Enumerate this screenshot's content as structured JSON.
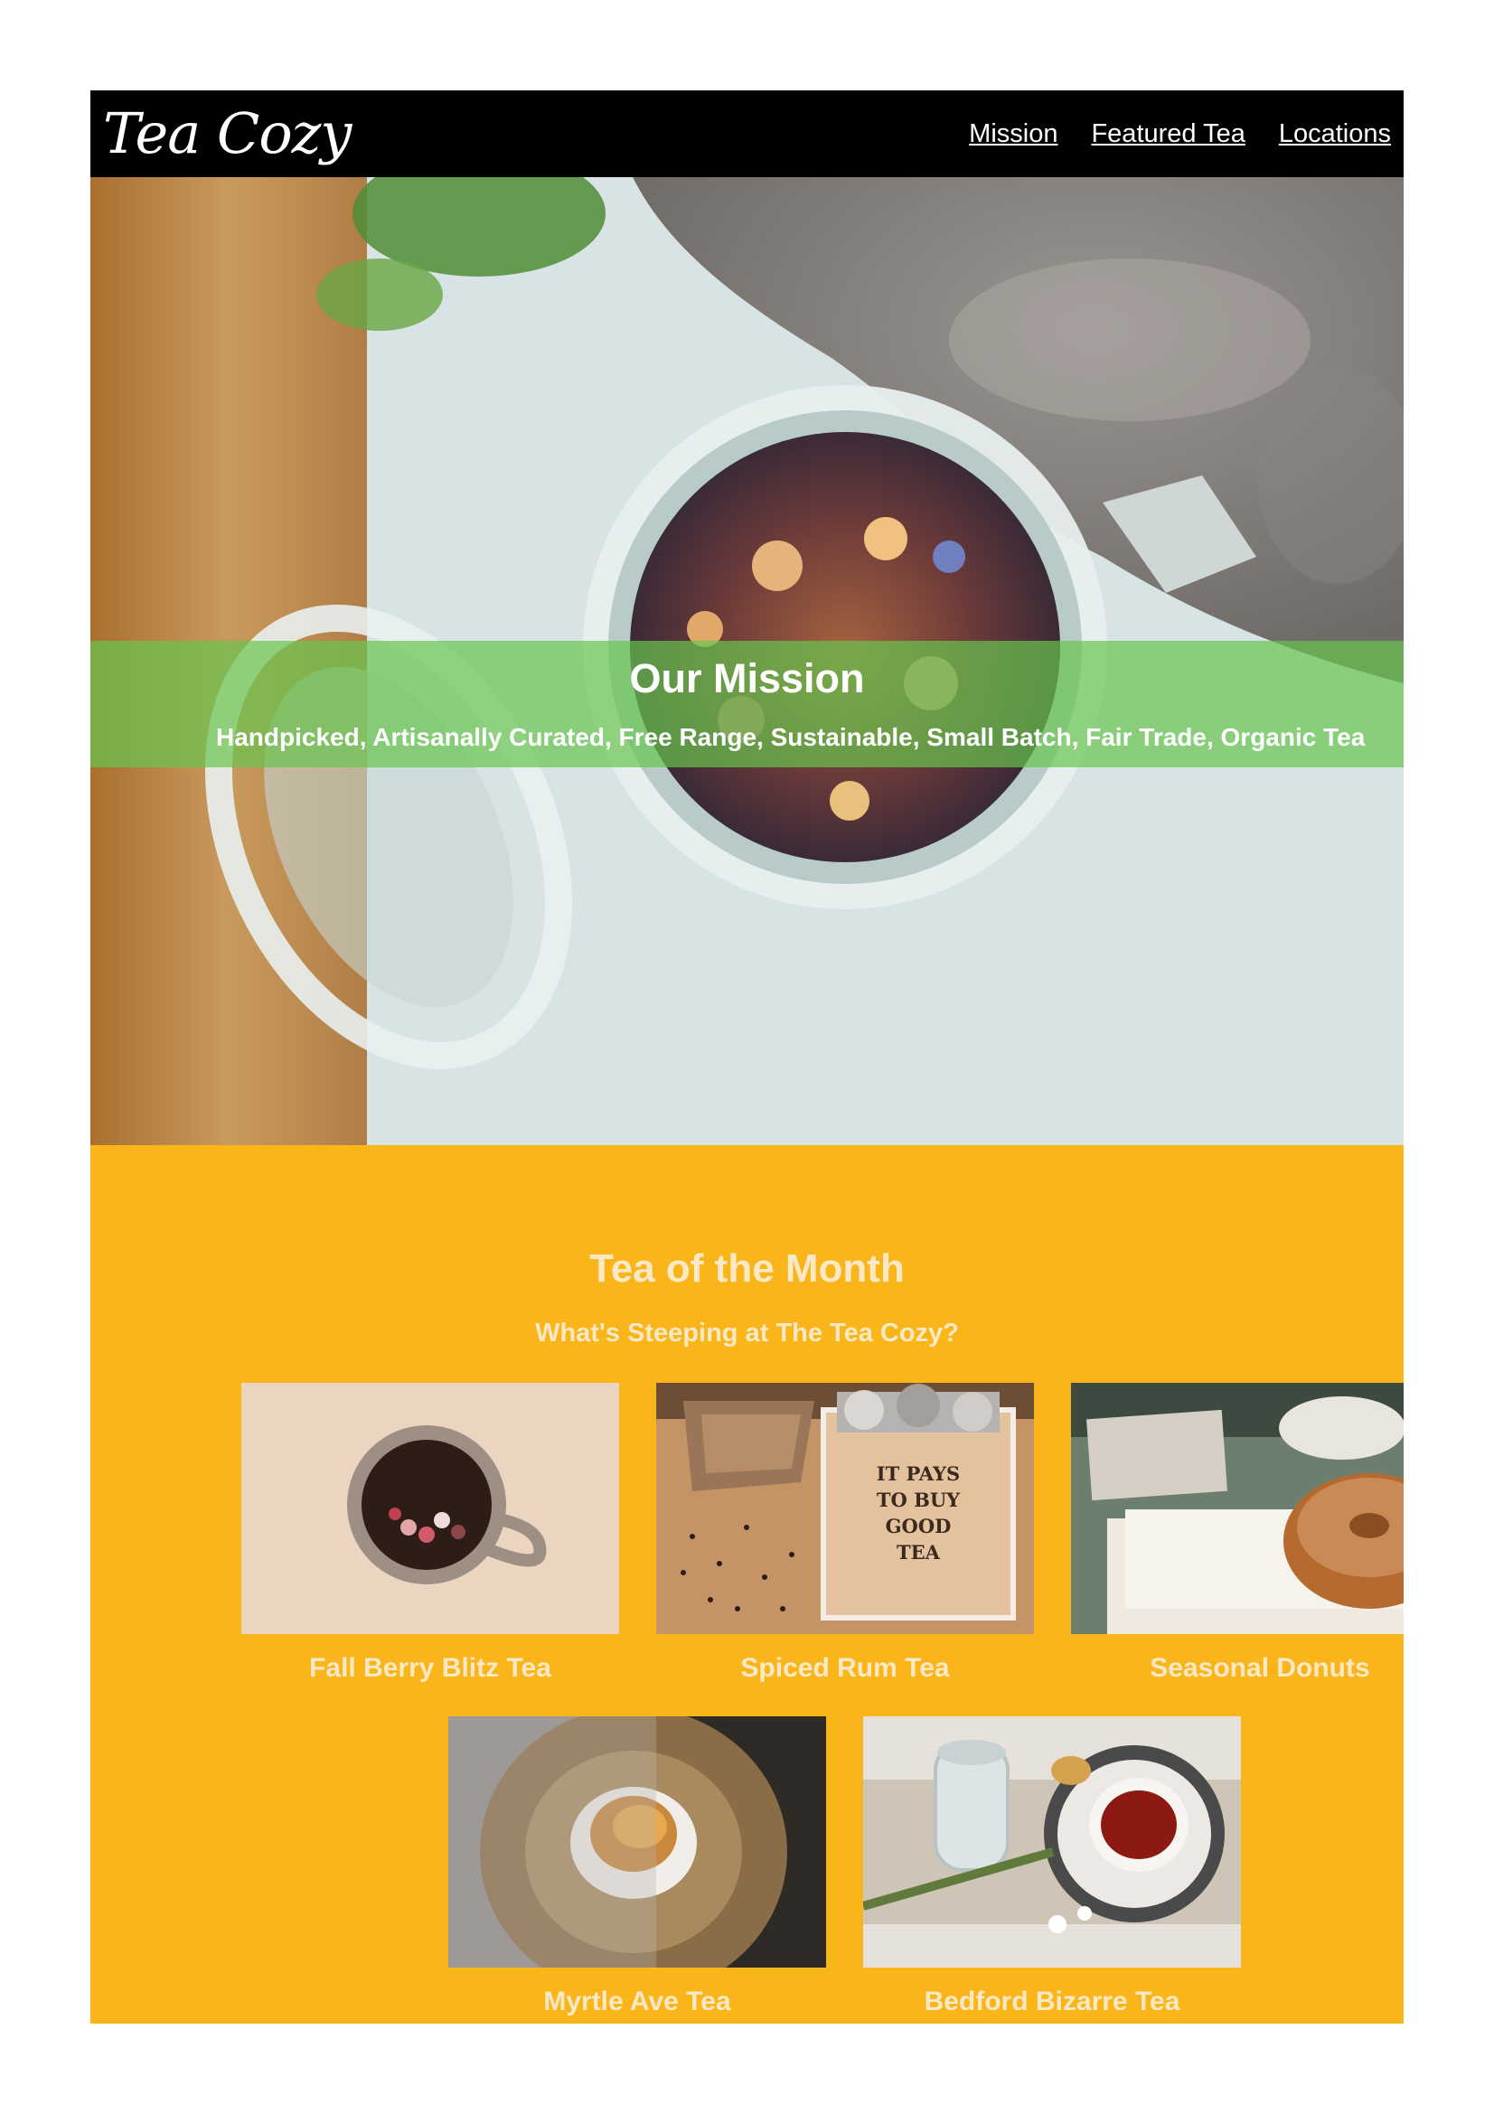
{
  "header": {
    "logo": "Tea Cozy",
    "nav": [
      "Mission",
      "Featured Tea",
      "Locations"
    ]
  },
  "hero": {
    "title": "Our Mission",
    "subtitle": "Handpicked, Artisanally Curated, Free Range, Sustainable, Small Batch, Fair Trade, Organic Tea"
  },
  "tea_of_month": {
    "title": "Tea of the Month",
    "subtitle": "What's Steeping at The Tea Cozy?",
    "items": [
      {
        "label": "Fall Berry Blitz Tea"
      },
      {
        "label": "Spiced Rum Tea"
      },
      {
        "label": "Seasonal Donuts"
      },
      {
        "label": "Myrtle Ave Tea"
      },
      {
        "label": "Bedford Bizarre Tea"
      }
    ],
    "crate_text": "IT PAYS TO BUY GOOD TEA"
  },
  "colors": {
    "header_bg": "#000000",
    "mission_band": "#68c44e",
    "section_bg": "#f9b51a",
    "section_text": "#fbe9c6"
  }
}
